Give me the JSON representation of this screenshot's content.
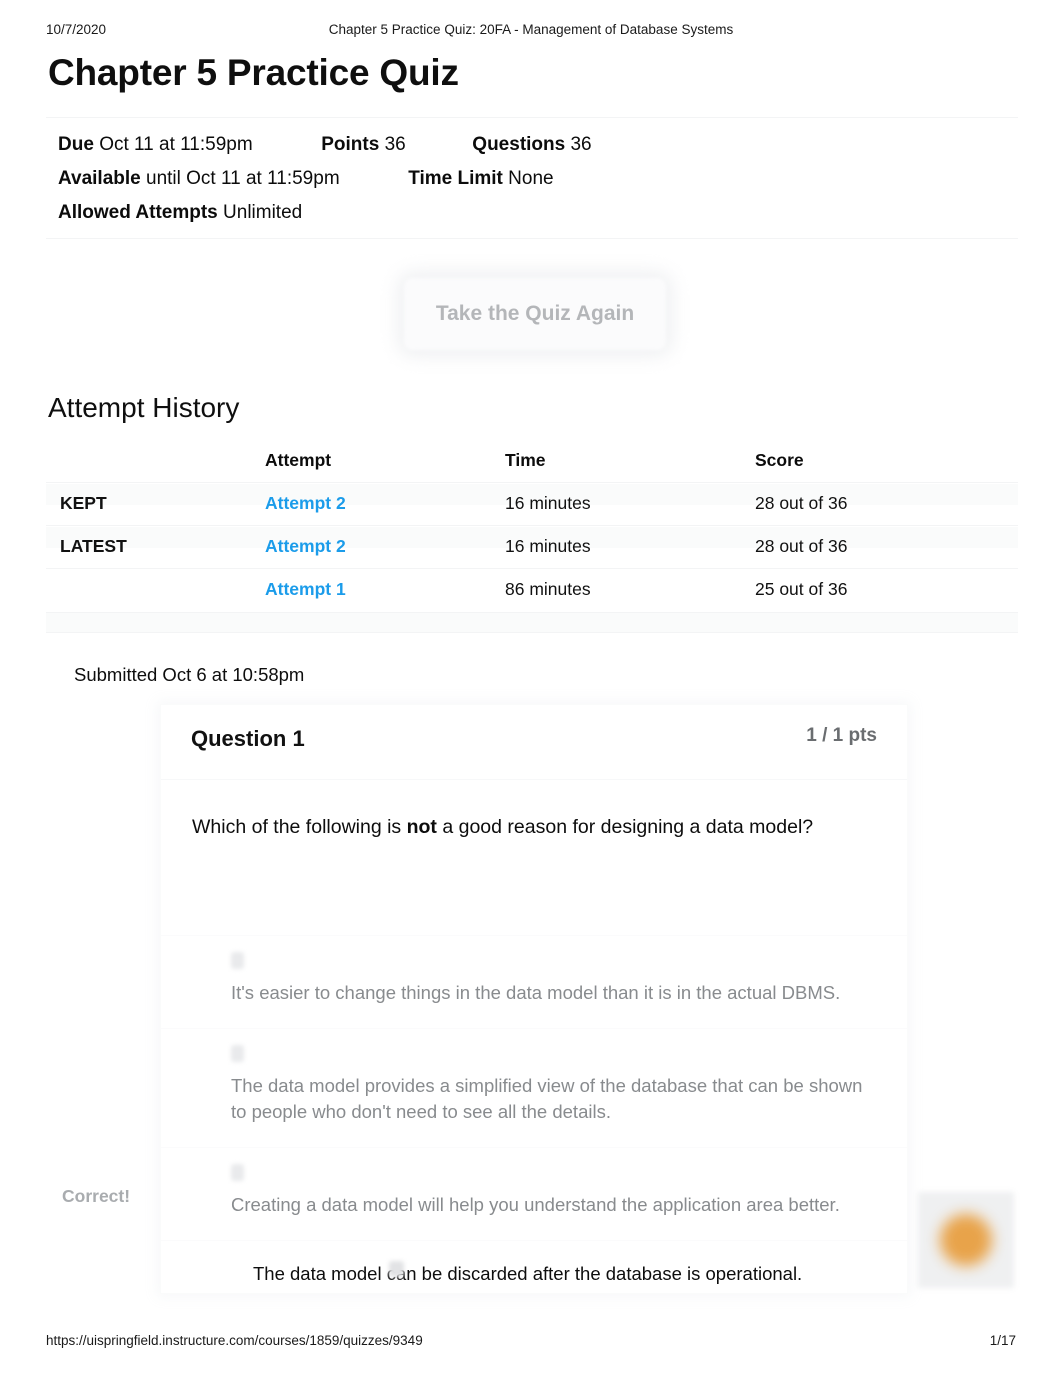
{
  "print_header": {
    "date": "10/7/2020",
    "title": "Chapter 5 Practice Quiz: 20FA - Management of Database Systems"
  },
  "page_title": "Chapter 5 Practice Quiz",
  "quiz_meta": {
    "due_label": "Due",
    "due_value": "Oct 11 at 11:59pm",
    "points_label": "Points",
    "points_value": "36",
    "questions_label": "Questions",
    "questions_value": "36",
    "available_label": "Available",
    "available_value": "until Oct 11 at 11:59pm",
    "time_limit_label": "Time Limit",
    "time_limit_value": "None",
    "allowed_attempts_label": "Allowed Attempts",
    "allowed_attempts_value": "Unlimited"
  },
  "retake_button": {
    "label": "Take the Quiz Again"
  },
  "attempt_history": {
    "section_title": "Attempt History",
    "columns": {
      "status": "",
      "attempt": "Attempt",
      "time": "Time",
      "score": "Score"
    },
    "rows": [
      {
        "status": "KEPT",
        "attempt": "Attempt 2",
        "time": "16 minutes",
        "score": "28 out of 36"
      },
      {
        "status": "LATEST",
        "attempt": "Attempt 2",
        "time": "16 minutes",
        "score": "28 out of 36"
      },
      {
        "status": "",
        "attempt": "Attempt 1",
        "time": "86 minutes",
        "score": "25 out of 36"
      }
    ]
  },
  "submitted": "Submitted Oct 6 at 10:58pm",
  "question": {
    "number_label": "Question 1",
    "points_label": "1 / 1 pts",
    "prompt_before": "Which of the following is ",
    "prompt_emphasis": "not",
    "prompt_after": " a good reason for designing a data model?",
    "correct_flag": "Correct!",
    "answers": [
      {
        "text": "It's easier to change things in the data model than it is in the actual DBMS.",
        "selected": false
      },
      {
        "text": "The data model provides a simplified view of the database that can be shown to people who don't need to see all the details.",
        "selected": false
      },
      {
        "text": "Creating a data model will help you understand the application area better.",
        "selected": false
      },
      {
        "text": "The data model can be discarded after the database is operational.",
        "selected": true
      }
    ]
  },
  "footer": {
    "url": "https://uispringfield.instructure.com/courses/1859/quizzes/9349",
    "page": "1/17"
  },
  "colors": {
    "link_blue": "#1b9cea",
    "muted_gray": "#888b8e",
    "blob_orange": "#e8a34a"
  }
}
